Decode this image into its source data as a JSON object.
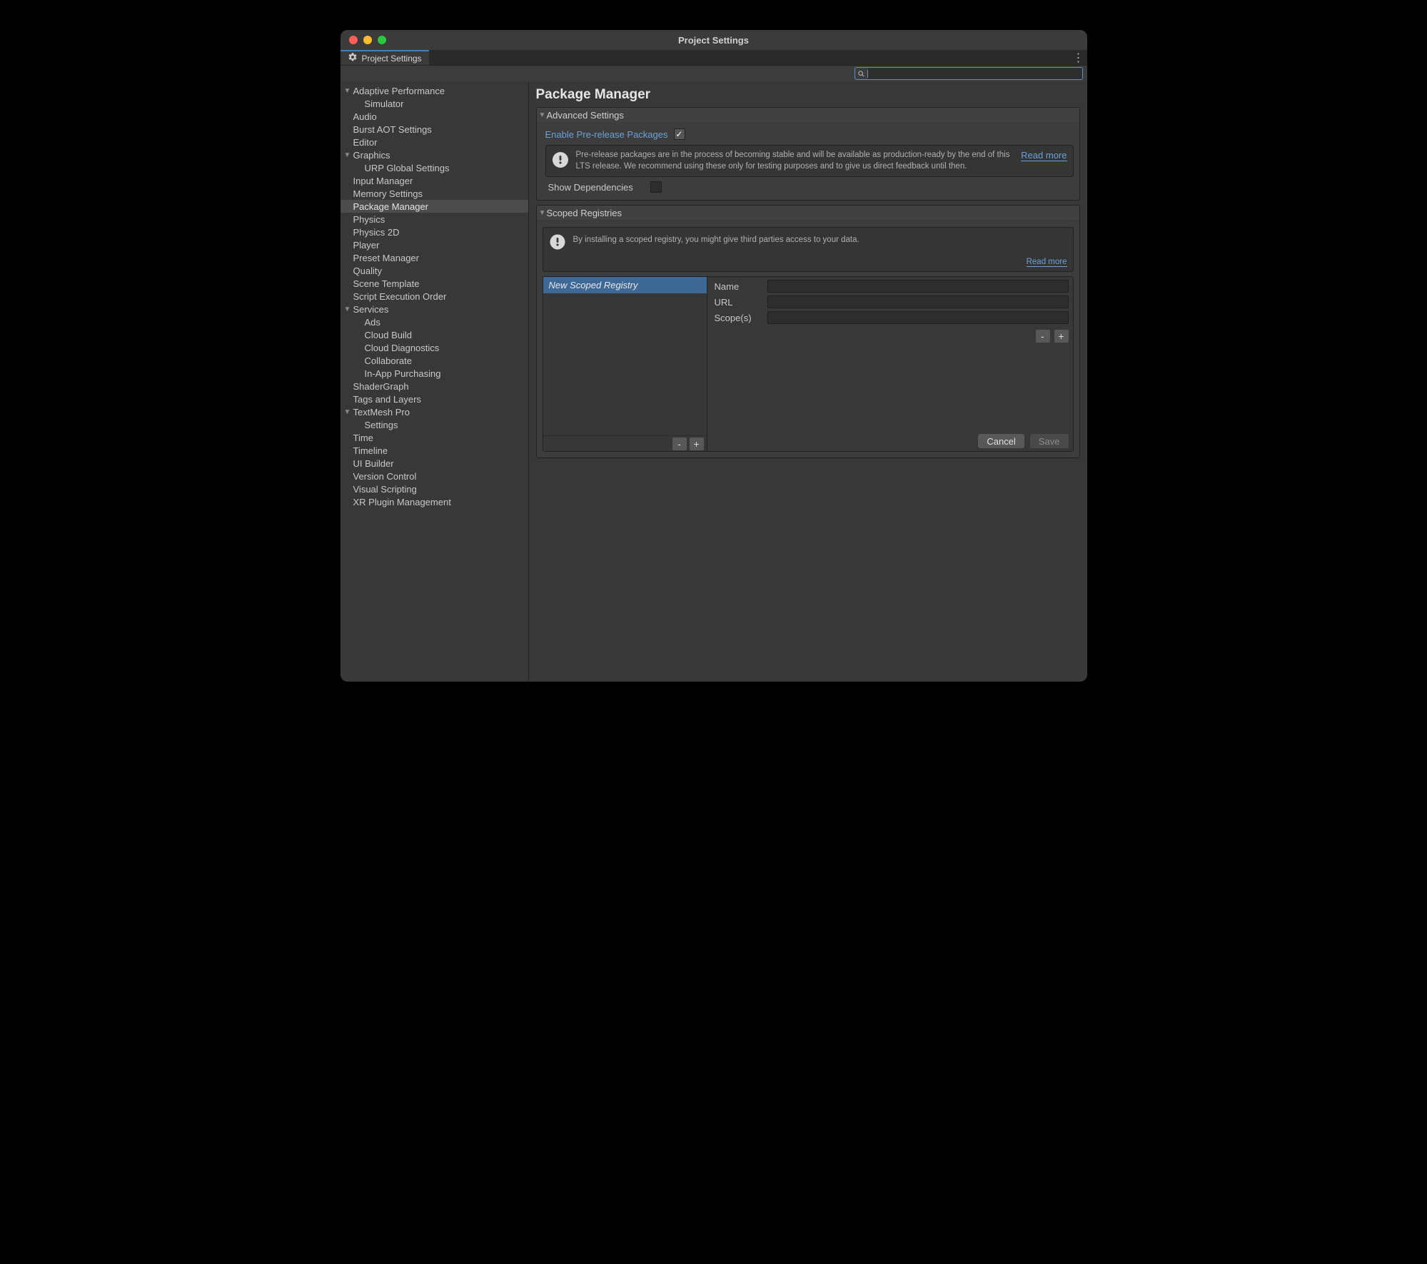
{
  "window": {
    "title": "Project Settings"
  },
  "tab": {
    "label": "Project Settings"
  },
  "search": {
    "value": ""
  },
  "sidebar": {
    "items": [
      {
        "label": "Adaptive Performance",
        "expandable": true,
        "expanded": true,
        "indent": 0
      },
      {
        "label": "Simulator",
        "indent": 1
      },
      {
        "label": "Audio",
        "indent": 0
      },
      {
        "label": "Burst AOT Settings",
        "indent": 0
      },
      {
        "label": "Editor",
        "indent": 0
      },
      {
        "label": "Graphics",
        "expandable": true,
        "expanded": true,
        "indent": 0
      },
      {
        "label": "URP Global Settings",
        "indent": 1
      },
      {
        "label": "Input Manager",
        "indent": 0
      },
      {
        "label": "Memory Settings",
        "indent": 0
      },
      {
        "label": "Package Manager",
        "indent": 0,
        "selected": true
      },
      {
        "label": "Physics",
        "indent": 0
      },
      {
        "label": "Physics 2D",
        "indent": 0
      },
      {
        "label": "Player",
        "indent": 0
      },
      {
        "label": "Preset Manager",
        "indent": 0
      },
      {
        "label": "Quality",
        "indent": 0
      },
      {
        "label": "Scene Template",
        "indent": 0
      },
      {
        "label": "Script Execution Order",
        "indent": 0
      },
      {
        "label": "Services",
        "expandable": true,
        "expanded": true,
        "indent": 0
      },
      {
        "label": "Ads",
        "indent": 1
      },
      {
        "label": "Cloud Build",
        "indent": 1
      },
      {
        "label": "Cloud Diagnostics",
        "indent": 1
      },
      {
        "label": "Collaborate",
        "indent": 1
      },
      {
        "label": "In-App Purchasing",
        "indent": 1
      },
      {
        "label": "ShaderGraph",
        "indent": 0
      },
      {
        "label": "Tags and Layers",
        "indent": 0
      },
      {
        "label": "TextMesh Pro",
        "expandable": true,
        "expanded": true,
        "indent": 0
      },
      {
        "label": "Settings",
        "indent": 1
      },
      {
        "label": "Time",
        "indent": 0
      },
      {
        "label": "Timeline",
        "indent": 0
      },
      {
        "label": "UI Builder",
        "indent": 0
      },
      {
        "label": "Version Control",
        "indent": 0
      },
      {
        "label": "Visual Scripting",
        "indent": 0
      },
      {
        "label": "XR Plugin Management",
        "indent": 0
      }
    ]
  },
  "main": {
    "title": "Package Manager",
    "advanced": {
      "header": "Advanced Settings",
      "enable_prerelease_label": "Enable Pre-release Packages",
      "enable_prerelease_checked": true,
      "info_text": "Pre-release packages are in the process of becoming stable and will be available as production-ready by the end of this LTS release. We recommend using these only for testing purposes and to give us direct feedback until then.",
      "read_more": "Read more",
      "show_deps_label": "Show Dependencies",
      "show_deps_checked": false
    },
    "scoped": {
      "header": "Scoped Registries",
      "info_text": "By installing a scoped registry, you might give third parties access to your data.",
      "read_more": "Read more",
      "selected_item": "New Scoped Registry",
      "form": {
        "name_label": "Name",
        "name_value": "",
        "url_label": "URL",
        "url_value": "",
        "scopes_label": "Scope(s)",
        "scopes_value": ""
      },
      "btn_minus": "-",
      "btn_plus": "+",
      "btn_cancel": "Cancel",
      "btn_save": "Save"
    }
  }
}
